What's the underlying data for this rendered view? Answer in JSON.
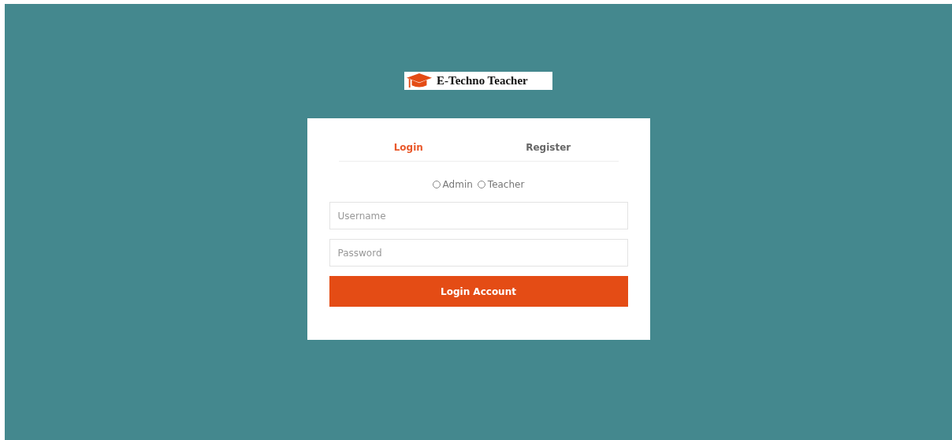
{
  "logo": {
    "text": "E-Techno Teacher"
  },
  "tabs": [
    {
      "label": "Login",
      "selected": true
    },
    {
      "label": "Register",
      "selected": false
    }
  ],
  "roles": [
    {
      "label": "Admin",
      "selected": false
    },
    {
      "label": "Teacher",
      "selected": false
    }
  ],
  "fields": [
    {
      "placeholder": "Username"
    },
    {
      "placeholder": "Password"
    }
  ],
  "submit": "Login Account"
}
